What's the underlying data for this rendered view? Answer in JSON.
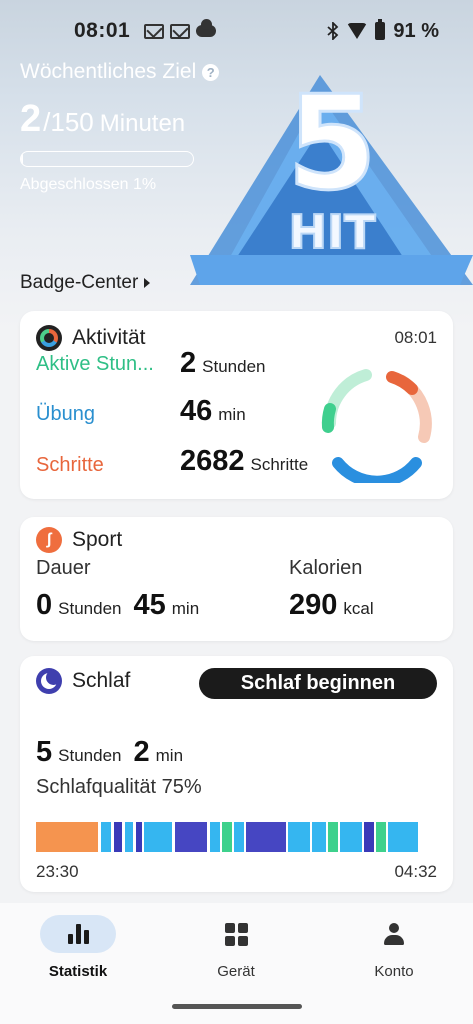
{
  "status_bar": {
    "time": "08:01",
    "battery": "91 %",
    "icons_left": [
      "gmail-icon",
      "gmail-icon",
      "cloud-icon"
    ],
    "icons_right": [
      "bluetooth-icon",
      "wifi-icon",
      "battery-icon"
    ]
  },
  "goal": {
    "title": "Wöchentliches Ziel",
    "help": "?",
    "current": "2",
    "separator": "/",
    "total": "150",
    "unit": "Minuten",
    "progress_percent": 1,
    "progress_label": "Abgeschlossen 1%"
  },
  "badge": {
    "art_top": "5",
    "art_bottom": "HIT",
    "center_label": "Badge-Center"
  },
  "activity": {
    "title": "Aktivität",
    "time": "08:01",
    "rows": [
      {
        "label": "Aktive Stun...",
        "value": "2",
        "unit": "Stunden",
        "color": "#2fbf86"
      },
      {
        "label": "Übung",
        "value": "46",
        "unit": "min",
        "color": "#2a8fcf"
      },
      {
        "label": "Schritte",
        "value": "2682",
        "unit": "Schritte",
        "color": "#e8663c"
      }
    ],
    "ring_colors": {
      "steps": "#e8663c",
      "exercise": "#2a8fdf",
      "active": "#3fcf8e"
    }
  },
  "sport": {
    "title": "Sport",
    "duration_label": "Dauer",
    "calories_label": "Kalorien",
    "hours": "0",
    "hours_unit": "Stunden",
    "minutes": "45",
    "minutes_unit": "min",
    "calories": "290",
    "calories_unit": "kcal"
  },
  "sleep": {
    "title": "Schlaf",
    "button": "Schlaf beginnen",
    "hours": "5",
    "hours_unit": "Stunden",
    "minutes": "2",
    "minutes_unit": "min",
    "quality": "Schlafqualität 75%",
    "start": "23:30",
    "end": "04:32",
    "stage_colors": {
      "awake": "#f5944f",
      "rem": "#4c4cc8",
      "light": "#35b6f0",
      "deep": "#1f3bb0",
      "nap": "#3ed18c"
    }
  },
  "nav": {
    "items": [
      {
        "label": "Statistik",
        "icon": "bar-chart-icon",
        "active": true
      },
      {
        "label": "Gerät",
        "icon": "grid-icon",
        "active": false
      },
      {
        "label": "Konto",
        "icon": "person-icon",
        "active": false
      }
    ]
  }
}
